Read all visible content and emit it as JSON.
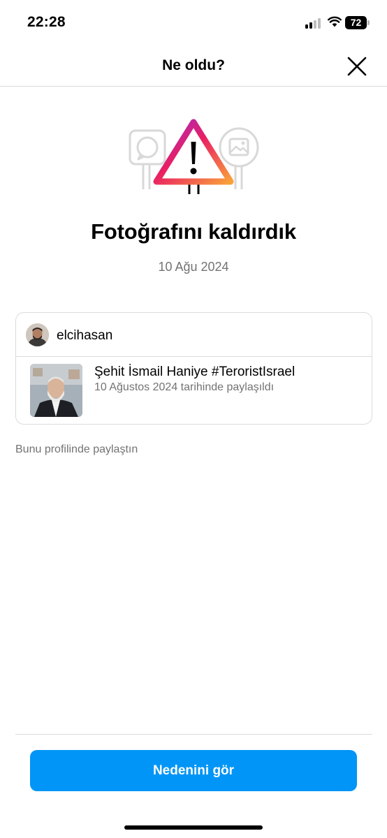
{
  "status_bar": {
    "time": "22:28",
    "battery_level": "72",
    "icons": [
      "cellular-signal-icon",
      "wifi-icon",
      "battery-icon"
    ]
  },
  "header": {
    "title": "Ne oldu?",
    "close_icon": "close-icon"
  },
  "notice": {
    "illustration": "warning-illustration",
    "title": "Fotoğrafını kaldırdık",
    "date": "10 Ağu 2024"
  },
  "post": {
    "username": "elcihasan",
    "caption": "Şehit İsmail Haniye #TeroristIsrael",
    "shared_date": "10 Ağustos 2024 tarihinde paylaşıldı"
  },
  "shared_note": "Bunu profilinde paylaştın",
  "actions": {
    "see_why_label": "Nedenini gör"
  },
  "colors": {
    "accent": "#0095f6",
    "secondary_text": "#737373",
    "divider": "#dbdbdb",
    "gradient": [
      "#f9a03a",
      "#e91e63",
      "#9b2fd1"
    ]
  }
}
